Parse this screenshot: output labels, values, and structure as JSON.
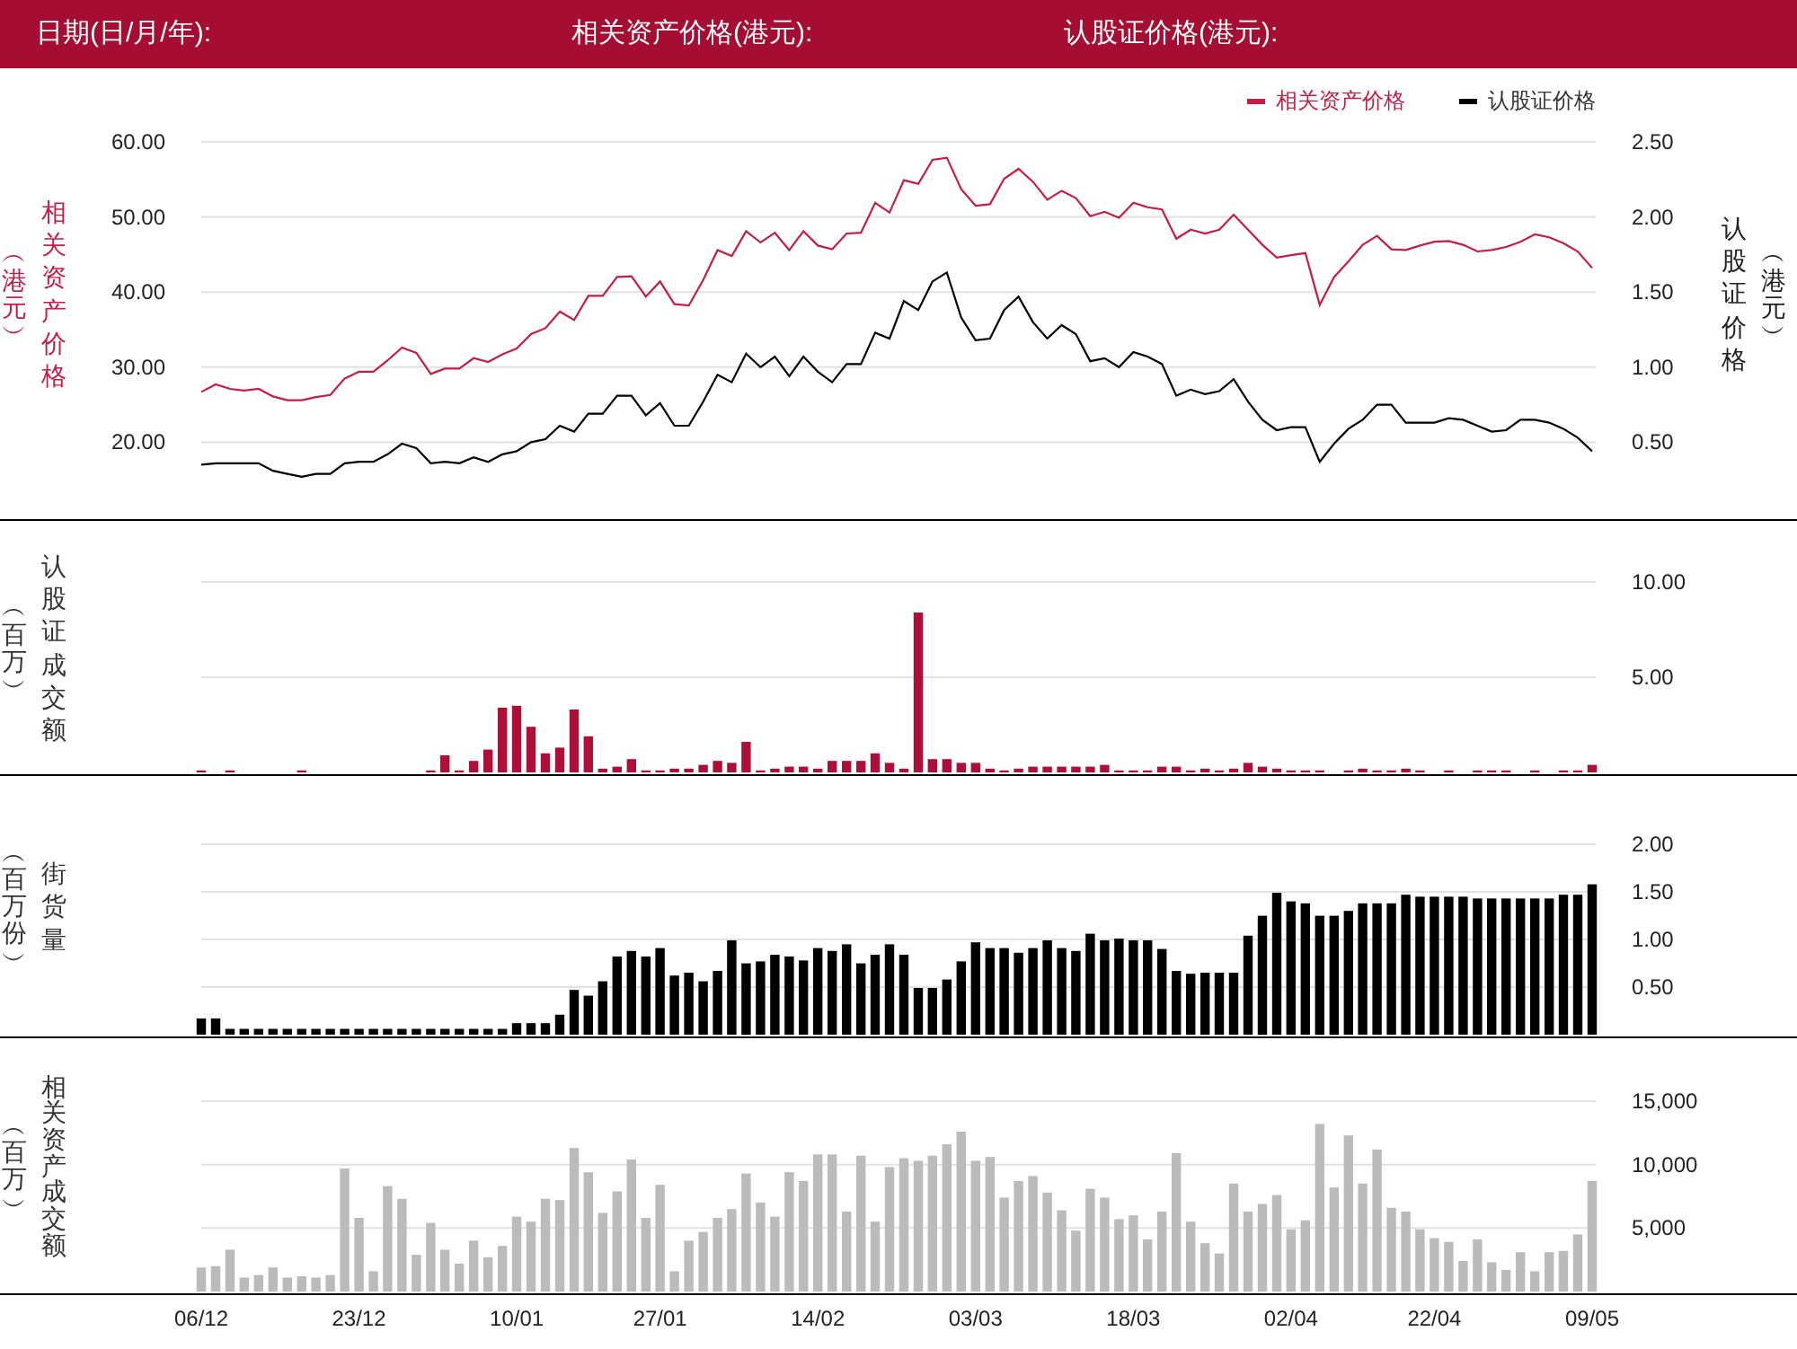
{
  "header": [
    {
      "label": "日期(日/月/年):"
    },
    {
      "label": "相关资产价格(港元):"
    },
    {
      "label": "认股证价格(港元):"
    }
  ],
  "panels": [
    {
      "kind": "line",
      "unit": "︵港元︶",
      "y2unit": "︵港元︶",
      "chart_data": {
        "type": "line",
        "ylabel": "相关资产价格",
        "y2label": "认股证价格",
        "grid": true,
        "legend": "top right",
        "ylim": [
          10,
          60
        ],
        "y2lim": [
          0,
          2.5
        ],
        "yticks": [
          {
            "value": 60,
            "label": "60.00"
          },
          {
            "value": 50,
            "label": "50.00"
          },
          {
            "value": 40,
            "label": "40.00"
          },
          {
            "value": 30,
            "label": "30.00"
          },
          {
            "value": 20,
            "label": "20.00"
          }
        ],
        "y2ticks": [
          {
            "value": 2.5,
            "label": "2.50"
          },
          {
            "value": 2.0,
            "label": "2.00"
          },
          {
            "value": 1.5,
            "label": "1.50"
          },
          {
            "value": 1.0,
            "label": "1.00"
          },
          {
            "value": 0.5,
            "label": "0.50"
          }
        ],
        "series": [
          {
            "name": "相关资产价格",
            "color": "#c41e45",
            "axis": "y",
            "values": [
              26.7,
              27.7,
              27.1,
              26.9,
              27.1,
              26.1,
              25.6,
              25.6,
              26.0,
              26.3,
              28.5,
              29.4,
              29.4,
              30.9,
              32.6,
              31.9,
              29.1,
              29.8,
              29.8,
              31.2,
              30.7,
              31.7,
              32.5,
              34.4,
              35.2,
              37.4,
              36.3,
              39.5,
              39.5,
              42.0,
              42.1,
              39.4,
              41.4,
              38.4,
              38.2,
              41.6,
              45.6,
              44.8,
              48.1,
              46.6,
              47.9,
              45.6,
              48.1,
              46.2,
              45.7,
              47.8,
              47.9,
              51.9,
              50.6,
              54.9,
              54.4,
              57.6,
              57.9,
              53.7,
              51.5,
              51.7,
              55.1,
              56.4,
              54.7,
              52.3,
              53.5,
              52.5,
              50.1,
              50.7,
              49.9,
              51.9,
              51.3,
              51.0,
              47.1,
              48.3,
              47.8,
              48.3,
              50.3,
              48.3,
              46.3,
              44.6,
              44.9,
              45.2,
              38.3,
              42.0,
              44.1,
              46.3,
              47.5,
              45.7,
              45.6,
              46.2,
              46.7,
              46.8,
              46.3,
              45.4,
              45.6,
              46.0,
              46.7,
              47.7,
              47.3,
              46.5,
              45.4,
              43.2
            ]
          },
          {
            "name": "认股证价格",
            "color": "#000000",
            "axis": "y2",
            "values": [
              0.35,
              0.36,
              0.36,
              0.36,
              0.36,
              0.31,
              0.29,
              0.27,
              0.29,
              0.29,
              0.36,
              0.37,
              0.37,
              0.42,
              0.49,
              0.46,
              0.36,
              0.37,
              0.36,
              0.4,
              0.37,
              0.42,
              0.44,
              0.5,
              0.52,
              0.61,
              0.57,
              0.69,
              0.69,
              0.81,
              0.81,
              0.68,
              0.76,
              0.61,
              0.61,
              0.77,
              0.95,
              0.9,
              1.09,
              1.0,
              1.07,
              0.94,
              1.07,
              0.97,
              0.9,
              1.02,
              1.02,
              1.23,
              1.19,
              1.44,
              1.38,
              1.57,
              1.63,
              1.33,
              1.18,
              1.19,
              1.38,
              1.47,
              1.3,
              1.19,
              1.28,
              1.22,
              1.04,
              1.06,
              1.0,
              1.1,
              1.07,
              1.02,
              0.81,
              0.85,
              0.82,
              0.84,
              0.92,
              0.77,
              0.65,
              0.58,
              0.6,
              0.6,
              0.37,
              0.49,
              0.59,
              0.65,
              0.75,
              0.75,
              0.63,
              0.63,
              0.63,
              0.66,
              0.65,
              0.61,
              0.57,
              0.58,
              0.65,
              0.65,
              0.63,
              0.59,
              0.53,
              0.44
            ]
          }
        ]
      }
    },
    {
      "kind": "bar",
      "unit": "︵百万︶",
      "chart_data": {
        "type": "bar",
        "ylabel": "认股证成交额",
        "grid": true,
        "ylim": [
          0,
          10
        ],
        "yticks": [
          {
            "value": 10,
            "label": "10.00"
          },
          {
            "value": 5,
            "label": "5.00"
          }
        ],
        "series": [
          {
            "color": "#ad0f37",
            "values": [
              0.1,
              0,
              0.1,
              0,
              0,
              0,
              0,
              0.1,
              0,
              0,
              0,
              0,
              0,
              0,
              0,
              0,
              0.1,
              0.9,
              0.1,
              0.6,
              1.2,
              3.4,
              3.5,
              2.4,
              1.0,
              1.3,
              3.3,
              1.9,
              0.2,
              0.3,
              0.7,
              0.1,
              0.1,
              0.2,
              0.2,
              0.4,
              0.6,
              0.5,
              1.6,
              0.1,
              0.2,
              0.3,
              0.3,
              0.2,
              0.6,
              0.6,
              0.6,
              1.0,
              0.5,
              0.2,
              8.4,
              0.7,
              0.7,
              0.5,
              0.5,
              0.2,
              0.1,
              0.2,
              0.3,
              0.3,
              0.3,
              0.3,
              0.3,
              0.4,
              0.1,
              0.1,
              0.1,
              0.3,
              0.3,
              0.1,
              0.2,
              0.1,
              0.2,
              0.5,
              0.3,
              0.2,
              0.1,
              0.1,
              0.1,
              0,
              0.1,
              0.2,
              0.1,
              0.1,
              0.2,
              0.1,
              0,
              0.1,
              0,
              0.1,
              0.1,
              0.1,
              0,
              0.1,
              0,
              0.1,
              0.1,
              0.4
            ]
          }
        ]
      }
    },
    {
      "kind": "bar",
      "unit": "︵百万份︶",
      "chart_data": {
        "type": "bar",
        "ylabel": "街货量",
        "grid": true,
        "ylim": [
          0,
          2
        ],
        "yticks": [
          {
            "value": 2.0,
            "label": "2.00"
          },
          {
            "value": 1.5,
            "label": "1.50"
          },
          {
            "value": 1.0,
            "label": "1.00"
          },
          {
            "value": 0.5,
            "label": "0.50"
          }
        ],
        "series": [
          {
            "color": "#000000",
            "values": [
              0.17,
              0.17,
              0.06,
              0.06,
              0.06,
              0.06,
              0.06,
              0.06,
              0.06,
              0.06,
              0.06,
              0.06,
              0.06,
              0.06,
              0.06,
              0.06,
              0.06,
              0.06,
              0.06,
              0.06,
              0.06,
              0.06,
              0.12,
              0.12,
              0.12,
              0.21,
              0.47,
              0.41,
              0.56,
              0.82,
              0.88,
              0.82,
              0.91,
              0.62,
              0.65,
              0.56,
              0.67,
              0.99,
              0.75,
              0.77,
              0.84,
              0.82,
              0.78,
              0.91,
              0.88,
              0.95,
              0.75,
              0.84,
              0.95,
              0.84,
              0.49,
              0.49,
              0.58,
              0.77,
              0.97,
              0.91,
              0.91,
              0.86,
              0.91,
              0.99,
              0.91,
              0.88,
              1.06,
              0.99,
              1.01,
              0.99,
              0.99,
              0.9,
              0.67,
              0.64,
              0.65,
              0.65,
              0.65,
              1.04,
              1.25,
              1.49,
              1.4,
              1.38,
              1.25,
              1.25,
              1.3,
              1.38,
              1.38,
              1.38,
              1.47,
              1.45,
              1.45,
              1.45,
              1.45,
              1.43,
              1.43,
              1.43,
              1.43,
              1.43,
              1.43,
              1.47,
              1.47,
              1.58
            ]
          }
        ]
      }
    },
    {
      "kind": "bar",
      "unit": "︵百万︶",
      "chart_data": {
        "type": "bar",
        "ylabel": "相关资产成交额",
        "grid": true,
        "ylim": [
          0,
          15000
        ],
        "yticks": [
          {
            "value": 15000,
            "label": "15,000"
          },
          {
            "value": 10000,
            "label": "10,000"
          },
          {
            "value": 5000,
            "label": "5,000"
          }
        ],
        "categories": [
          "06/12",
          null,
          null,
          null,
          null,
          null,
          null,
          null,
          null,
          null,
          null,
          "23/12",
          null,
          null,
          null,
          null,
          null,
          null,
          null,
          null,
          null,
          null,
          "10/01",
          null,
          null,
          null,
          null,
          null,
          null,
          null,
          null,
          null,
          "27/01",
          null,
          null,
          null,
          null,
          null,
          null,
          null,
          null,
          null,
          null,
          "14/02",
          null,
          null,
          null,
          null,
          null,
          null,
          null,
          null,
          null,
          null,
          "03/03",
          null,
          null,
          null,
          null,
          null,
          null,
          null,
          null,
          null,
          null,
          "18/03",
          null,
          null,
          null,
          null,
          null,
          null,
          null,
          null,
          null,
          null,
          "02/04",
          null,
          null,
          null,
          null,
          null,
          null,
          null,
          null,
          null,
          "22/04",
          null,
          null,
          null,
          null,
          null,
          null,
          null,
          null,
          null,
          null,
          "09/05"
        ],
        "series": [
          {
            "color": "#bbbbbb",
            "values": [
              1900,
              2000,
              3300,
              1100,
              1300,
              1900,
              1100,
              1200,
              1100,
              1300,
              9700,
              5800,
              1600,
              8300,
              7300,
              2900,
              5400,
              3300,
              2200,
              4000,
              2700,
              3600,
              5900,
              5500,
              7300,
              7200,
              11300,
              9400,
              6200,
              7900,
              10400,
              5800,
              8400,
              1600,
              4000,
              4700,
              5800,
              6500,
              9300,
              7000,
              5900,
              9400,
              8700,
              10800,
              10800,
              6300,
              10700,
              5500,
              9800,
              10500,
              10300,
              10700,
              11600,
              12600,
              10300,
              10600,
              7400,
              8700,
              9100,
              7800,
              6400,
              4800,
              8100,
              7400,
              5700,
              6000,
              4100,
              6300,
              10900,
              5500,
              3800,
              3000,
              8500,
              6300,
              6900,
              7600,
              4900,
              5600,
              13200,
              8200,
              12300,
              8500,
              11200,
              6600,
              6300,
              4900,
              4200,
              3900,
              2400,
              4100,
              2300,
              1700,
              3100,
              1600,
              3100,
              3200,
              4500,
              8700
            ]
          }
        ]
      }
    }
  ]
}
